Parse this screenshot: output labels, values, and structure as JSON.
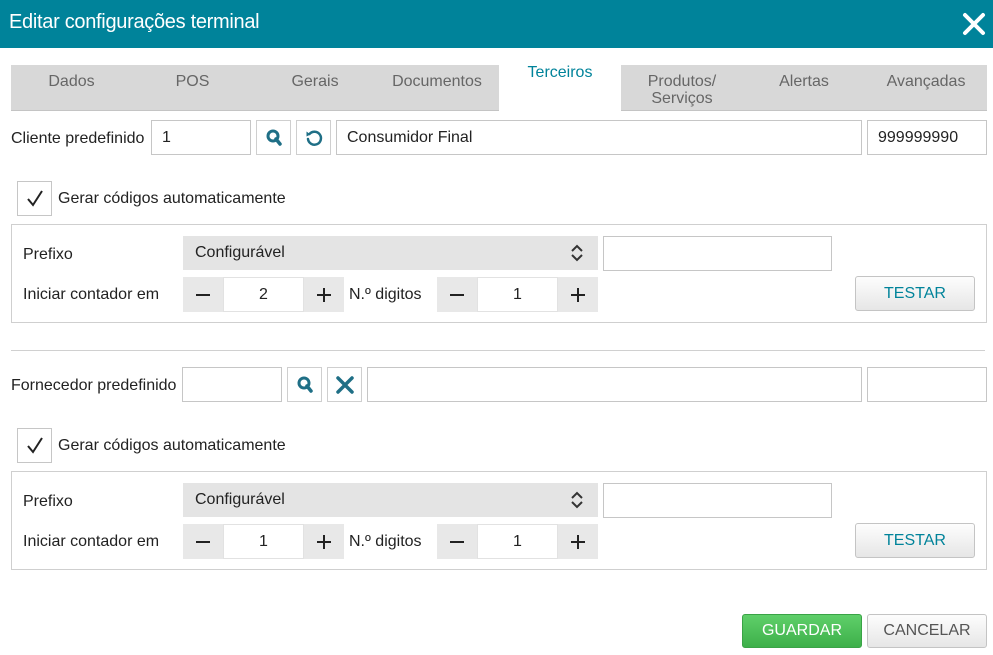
{
  "dialog": {
    "title": "Editar configurações terminal",
    "close_icon": "close-icon"
  },
  "tabs": [
    {
      "label": "Dados"
    },
    {
      "label": "POS"
    },
    {
      "label": "Gerais"
    },
    {
      "label": "Documentos"
    },
    {
      "label": "Terceiros",
      "active": true
    },
    {
      "label": "Produtos/\nServiços"
    },
    {
      "label": "Alertas"
    },
    {
      "label": "Avançadas"
    }
  ],
  "cliente": {
    "label": "Cliente predefinido",
    "code": "1",
    "name": "Consumidor Final",
    "nif": "999999990",
    "search_icon": "search-icon",
    "reset_icon": "refresh-icon",
    "auto_codes_label": "Gerar códigos automaticamente",
    "auto_codes_checked": true,
    "prefixo_label": "Prefixo",
    "prefixo_select": "Configurável",
    "prefixo_value": "",
    "counter_label": "Iniciar contador em",
    "counter_value": "2",
    "digits_label": "N.º digitos",
    "digits_value": "1",
    "test_label": "TESTAR"
  },
  "fornecedor": {
    "label": "Fornecedor predefinido",
    "code": "",
    "name": "",
    "nif": "",
    "search_icon": "search-icon",
    "clear_icon": "clear-icon",
    "auto_codes_label": "Gerar códigos automaticamente",
    "auto_codes_checked": true,
    "prefixo_label": "Prefixo",
    "prefixo_select": "Configurável",
    "prefixo_value": "",
    "counter_label": "Iniciar contador em",
    "counter_value": "1",
    "digits_label": "N.º digitos",
    "digits_value": "1",
    "test_label": "TESTAR"
  },
  "footer": {
    "save_label": "GUARDAR",
    "cancel_label": "CANCELAR"
  },
  "colors": {
    "header": "#00839a",
    "accent": "#00839a",
    "save": "#4cbf58"
  }
}
